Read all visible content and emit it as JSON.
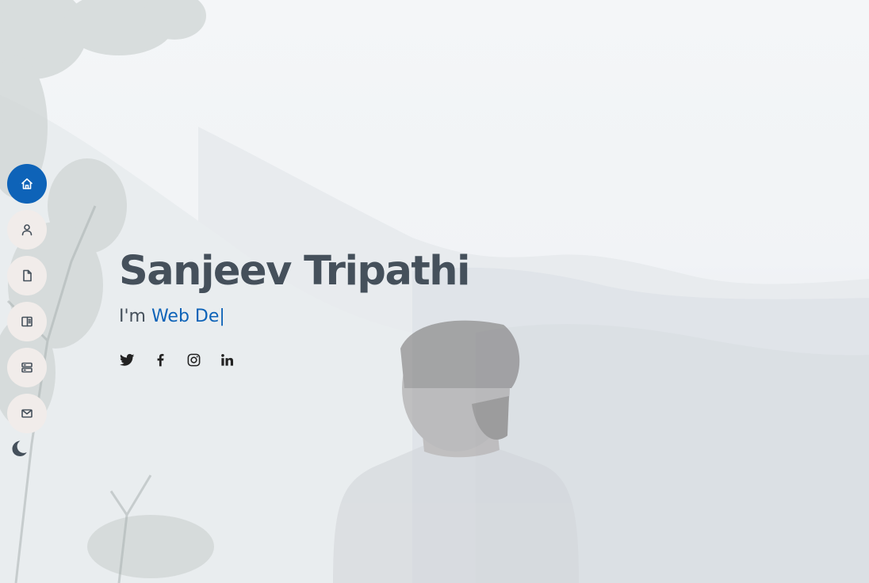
{
  "hero": {
    "name": "Sanjeev Tripathi",
    "intro": "I'm ",
    "typed_text": "Web De",
    "cursor": "|"
  },
  "nav": {
    "items": [
      {
        "icon": "home-icon",
        "active": true
      },
      {
        "icon": "person-icon",
        "active": false
      },
      {
        "icon": "file-icon",
        "active": false
      },
      {
        "icon": "book-icon",
        "active": false
      },
      {
        "icon": "server-icon",
        "active": false
      },
      {
        "icon": "envelope-icon",
        "active": false
      }
    ],
    "theme_toggle_icon": "moon-icon"
  },
  "social": [
    "twitter-icon",
    "facebook-icon",
    "instagram-icon",
    "linkedin-icon"
  ],
  "colors": {
    "accent": "#0e63b8",
    "text": "#45505b",
    "nav_bg": "#f1ecea"
  }
}
